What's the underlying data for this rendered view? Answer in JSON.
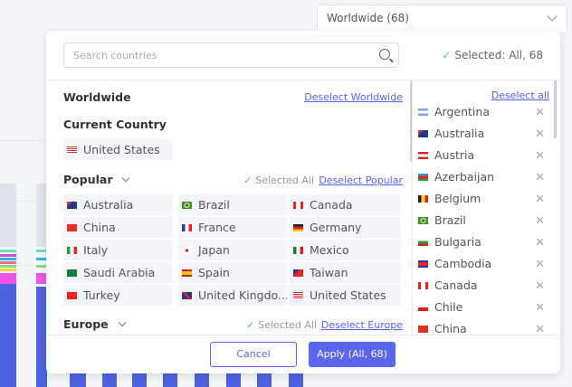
{
  "dropdown": {
    "label": "Worldwide (68)"
  },
  "search": {
    "placeholder": "Search countries"
  },
  "selected_summary": "Selected: All, 68",
  "sections": {
    "worldwide": {
      "title": "Worldwide",
      "deselect": "Deselect Worldwide"
    },
    "current": {
      "title": "Current Country",
      "country": "United States"
    },
    "popular": {
      "title": "Popular",
      "status": "Selected All",
      "deselect": "Deselect Popular",
      "countries": [
        "Australia",
        "Brazil",
        "Canada",
        "China",
        "France",
        "Germany",
        "Italy",
        "Japan",
        "Mexico",
        "Saudi Arabia",
        "Spain",
        "Taiwan",
        "Turkey",
        "United Kingdo...",
        "United States"
      ]
    },
    "europe": {
      "title": "Europe",
      "status": "Selected All",
      "deselect": "Deselect Europe"
    }
  },
  "selected_list": {
    "deselect_all": "Deselect all",
    "items": [
      "Argentina",
      "Australia",
      "Austria",
      "Azerbaijan",
      "Belgium",
      "Brazil",
      "Bulgaria",
      "Cambodia",
      "Canada",
      "Chile",
      "China"
    ]
  },
  "buttons": {
    "cancel": "Cancel",
    "apply": "Apply (All, 68)"
  },
  "colors": {
    "accent": "#5a66f0",
    "check": "#5cc77a",
    "bar": "#4d62e0"
  }
}
